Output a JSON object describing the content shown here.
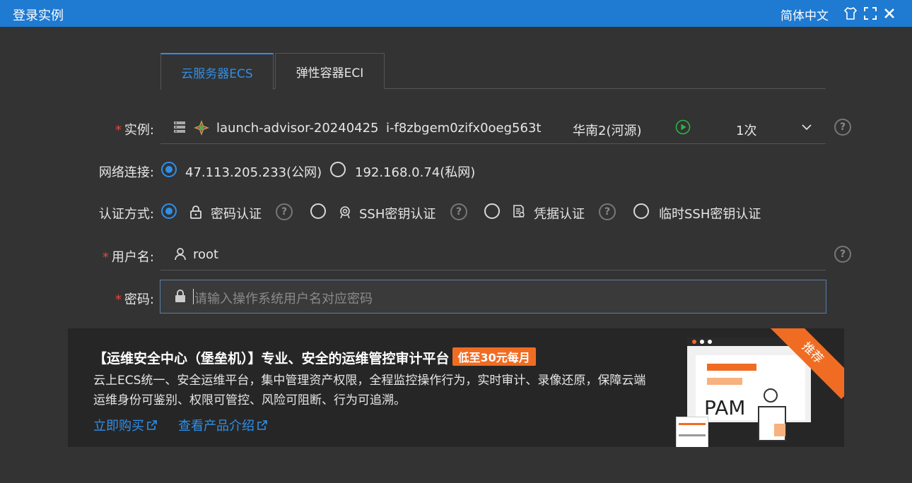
{
  "window": {
    "title": "登录实例",
    "language": "简体中文"
  },
  "tabs": [
    {
      "label": "云服务器ECS",
      "active": true
    },
    {
      "label": "弹性容器ECI",
      "active": false
    }
  ],
  "instance": {
    "label": "实例:",
    "name": "launch-advisor-20240425",
    "id": "i-f8zbgem0zifx0oeg563t",
    "region": "华南2(河源)",
    "count": "1次",
    "status": "running"
  },
  "network": {
    "label": "网络连接:",
    "options": [
      {
        "label": "47.113.205.233(公网)",
        "selected": true
      },
      {
        "label": "192.168.0.74(私网)",
        "selected": false
      }
    ]
  },
  "auth": {
    "label": "认证方式:",
    "options": [
      {
        "label": "密码认证",
        "selected": true
      },
      {
        "label": "SSH密钥认证",
        "selected": false
      },
      {
        "label": "凭据认证",
        "selected": false
      },
      {
        "label": "临时SSH密钥认证",
        "selected": false
      }
    ]
  },
  "username": {
    "label": "用户名:",
    "value": "root"
  },
  "password": {
    "label": "密码:",
    "placeholder": "请输入操作系统用户名对应密码",
    "value": ""
  },
  "banner": {
    "title": "【运维安全中心（堡垒机）】专业、安全的运维管控审计平台",
    "badge": "低至30元每月",
    "line1": "云上ECS统一、安全运维平台，集中管理资产权限，全程监控操作行为，实时审计、录像还原，保障云端",
    "line2": "运维身份可鉴别、权限可管控、风险可阻断、行为可追溯。",
    "link_buy": "立即购买",
    "link_intro": "查看产品介绍",
    "ribbon": "推荐",
    "image_text": "PAM"
  },
  "colors": {
    "accent": "#2f8fe8",
    "titlebar": "#1f7ad1",
    "background": "#333333",
    "orange": "#f06c22",
    "required": "#e6463c"
  }
}
